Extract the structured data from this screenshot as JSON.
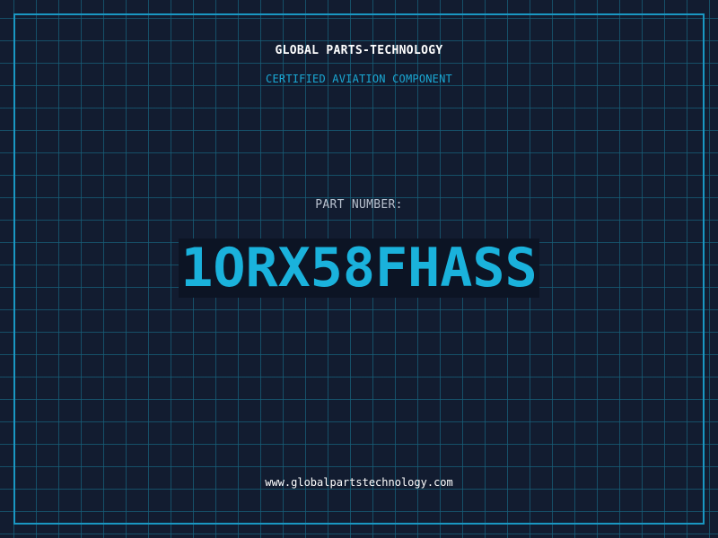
{
  "header": {
    "company": "GLOBAL PARTS-TECHNOLOGY",
    "subtitle": "CERTIFIED AVIATION COMPONENT"
  },
  "part": {
    "label": "PART NUMBER:",
    "number": "1ORX58FHASS",
    "color": "#1ab2dc"
  },
  "footer": {
    "url": "www.globalpartstechnology.com"
  },
  "colors": {
    "background": "#121c30",
    "grid": "#16607a",
    "frame": "#1a97c2",
    "accent": "#1aa8d4",
    "white": "#ffffff",
    "muted": "#b9c2cf"
  }
}
